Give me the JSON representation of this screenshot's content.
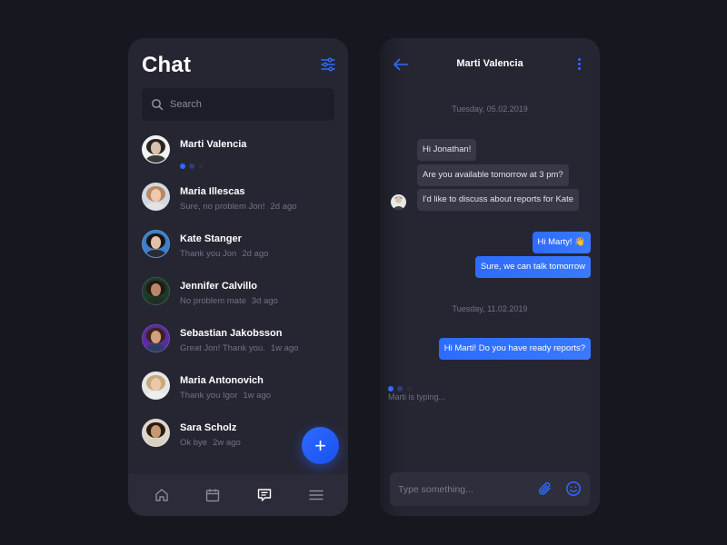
{
  "colors": {
    "background": "#17171f",
    "panel": "#262633",
    "accent": "#2e6bff",
    "muted_text": "#727287"
  },
  "contacts_screen": {
    "title": "Chat",
    "filter_icon": "sliders-icon",
    "search": {
      "placeholder": "Search",
      "icon": "search-icon"
    },
    "contacts": [
      {
        "name": "Marti Valencia",
        "preview": "",
        "time": "",
        "typing": true,
        "avatar": {
          "hair": "#2a2420",
          "skin": "#d8c2ad",
          "shirt": "#3a3a3a",
          "bg": "#f2f2f2"
        }
      },
      {
        "name": "Maria Illescas",
        "preview": "Sure, no problem Jon!",
        "time": "2d ago",
        "typing": false,
        "avatar": {
          "hair": "#b98a5e",
          "skin": "#f0c9ae",
          "shirt": "#e2e2e2",
          "bg": "#cfd9e3"
        }
      },
      {
        "name": "Kate Stanger",
        "preview": "Thank you Jon",
        "time": "2d ago",
        "typing": false,
        "avatar": {
          "hair": "#1c1412",
          "skin": "#e3c0a6",
          "shirt": "#2b2b34",
          "bg": "#3a7fc7"
        }
      },
      {
        "name": "Jennifer Calvillo",
        "preview": "No problem mate",
        "time": "3d ago",
        "typing": false,
        "avatar": {
          "hair": "#24180f",
          "skin": "#b8876a",
          "shirt": "#1f2f24",
          "bg": "#1a3a2a"
        }
      },
      {
        "name": "Sebastian Jakobsson",
        "preview": "Great Jon! Thank you.",
        "time": "1w ago",
        "typing": false,
        "avatar": {
          "hair": "#3a2418",
          "skin": "#d2a07c",
          "shirt": "#2a4060",
          "bg": "#5a2aa0"
        }
      },
      {
        "name": "Maria Antonovich",
        "preview": "Thank you Igor",
        "time": "1w ago",
        "typing": false,
        "avatar": {
          "hair": "#c8a878",
          "skin": "#ecc8aa",
          "shirt": "#efefef",
          "bg": "#e6e6e6"
        }
      },
      {
        "name": "Sara Scholz",
        "preview": "Ok bye",
        "time": "2w ago",
        "typing": false,
        "avatar": {
          "hair": "#2b1c12",
          "skin": "#c99873",
          "shirt": "#d8d0c2",
          "bg": "#dcd6cc"
        }
      }
    ],
    "fab_label": "+",
    "nav": [
      "home-icon",
      "calendar-icon",
      "chat-icon",
      "menu-icon"
    ],
    "nav_active": 2
  },
  "conversation_screen": {
    "contact_name": "Marti Valencia",
    "back_icon": "arrow-left-icon",
    "more_icon": "more-vertical-icon",
    "dates": [
      "Tuesday, 05.02.2019",
      "Tuesday, 11.02.2019"
    ],
    "messages": [
      {
        "from": "them",
        "text": "Hi Jonathan!"
      },
      {
        "from": "them",
        "text": "Are you available tomorrow at 3 pm?"
      },
      {
        "from": "them",
        "text": "I'd like to discuss about reports for Kate"
      },
      {
        "from": "me",
        "text": "Hi Marty! 👋"
      },
      {
        "from": "me",
        "text": "Sure, we can talk tomorrow"
      },
      {
        "from": "me",
        "text": "Hi Marti! Do you have ready reports?"
      }
    ],
    "typing_status": "Marti is typing...",
    "composer": {
      "placeholder": "Type something...",
      "attach_icon": "paperclip-icon",
      "emoji_icon": "smiley-icon"
    }
  }
}
